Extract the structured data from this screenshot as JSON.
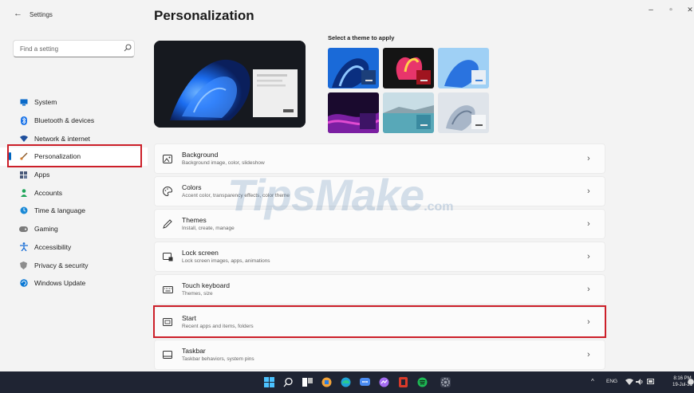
{
  "window": {
    "back_glyph": "←",
    "title": "Settings",
    "minimize_glyph": "–",
    "maximize_glyph": "▫",
    "close_glyph": "✕"
  },
  "search": {
    "placeholder": "Find a setting",
    "icon": "search-icon"
  },
  "sidebar": {
    "items": [
      {
        "label": "System",
        "icon": "monitor-icon",
        "color": "#0a6ac9"
      },
      {
        "label": "Bluetooth & devices",
        "icon": "bluetooth-icon",
        "color": "#1a73e8"
      },
      {
        "label": "Network & internet",
        "icon": "wifi-icon",
        "color": "#1f4f9c"
      },
      {
        "label": "Personalization",
        "icon": "brush-icon",
        "color": "#d07a2c",
        "active": true
      },
      {
        "label": "Apps",
        "icon": "apps-icon",
        "color": "#4a5a7a"
      },
      {
        "label": "Accounts",
        "icon": "person-icon",
        "color": "#1fa55a"
      },
      {
        "label": "Time & language",
        "icon": "globe-clock-icon",
        "color": "#1a89d6"
      },
      {
        "label": "Gaming",
        "icon": "gamepad-icon",
        "color": "#7b7b7b"
      },
      {
        "label": "Accessibility",
        "icon": "accessibility-icon",
        "color": "#1a6fd6"
      },
      {
        "label": "Privacy & security",
        "icon": "shield-icon",
        "color": "#6d6d6d"
      },
      {
        "label": "Windows Update",
        "icon": "update-icon",
        "color": "#0a78d4"
      }
    ]
  },
  "main": {
    "title": "Personalization",
    "theme_label": "Select a theme to apply",
    "settings": [
      {
        "title": "Background",
        "subtitle": "Background image, color, slideshow",
        "icon": "image-icon"
      },
      {
        "title": "Colors",
        "subtitle": "Accent color, transparency effects, color theme",
        "icon": "palette-icon"
      },
      {
        "title": "Themes",
        "subtitle": "Install, create, manage",
        "icon": "pen-icon"
      },
      {
        "title": "Lock screen",
        "subtitle": "Lock screen images, apps, animations",
        "icon": "lock-screen-icon"
      },
      {
        "title": "Touch keyboard",
        "subtitle": "Themes, size",
        "icon": "keyboard-icon"
      },
      {
        "title": "Start",
        "subtitle": "Recent apps and items, folders",
        "icon": "start-icon",
        "highlighted": true
      },
      {
        "title": "Taskbar",
        "subtitle": "Taskbar behaviors, system pins",
        "icon": "taskbar-icon"
      }
    ],
    "chevron": "›"
  },
  "watermark": {
    "main": "TipsMake",
    "suffix": ".com"
  },
  "taskbar": {
    "tray_chevron": "^",
    "language": "ENG",
    "time": "8:16 PM",
    "date": "19-Jul-21"
  },
  "colors": {
    "accent": "#0067c0",
    "highlight_border": "#cc1f29",
    "taskbar_bg": "#1f2433"
  }
}
